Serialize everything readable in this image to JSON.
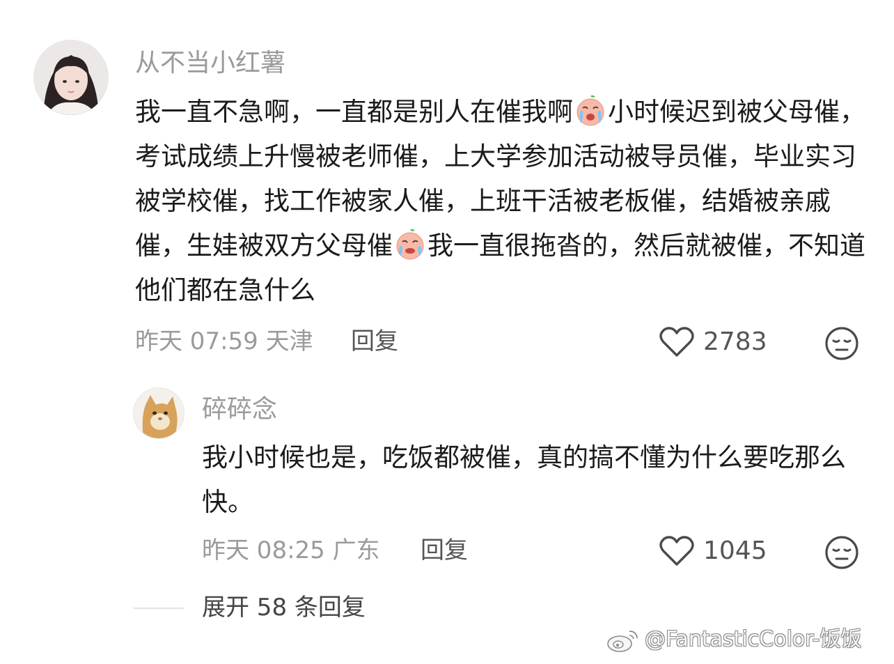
{
  "comment": {
    "username": "从不当小红薯",
    "text_part1": "我一直不急啊，一直都是别人在催我啊",
    "text_part2": "小时候迟到被父母催，考试成绩上升慢被老师催，上大学参加活动被导员催，毕业实习被学校催，找工作被家人催，上班干活被老板催，结婚被亲戚催，生娃被双方父母催",
    "text_part3": "我一直很拖沓的，然后就被催，不知道他们都在急什么",
    "emoji_1": "crying-face-emoji",
    "emoji_2": "crying-face-emoji",
    "time": "昨天 07:59 天津",
    "reply_label": "回复",
    "like_count": "2783"
  },
  "reply": {
    "username": "碎碎念",
    "text": "我小时候也是，吃饭都被催，真的搞不懂为什么要吃那么快。",
    "time": "昨天 08:25 广东",
    "reply_label": "回复",
    "like_count": "1045"
  },
  "expand_label": "展开 58 条回复",
  "watermark": "@FantasticColor-饭饭",
  "icons": {
    "like": "heart-outline-icon",
    "dislike": "meh-face-icon",
    "watermark_logo": "weibo-logo-icon"
  },
  "colors": {
    "meta_text": "#9a9a9a",
    "body_text": "#1b1b1b",
    "background": "#ffffff"
  }
}
